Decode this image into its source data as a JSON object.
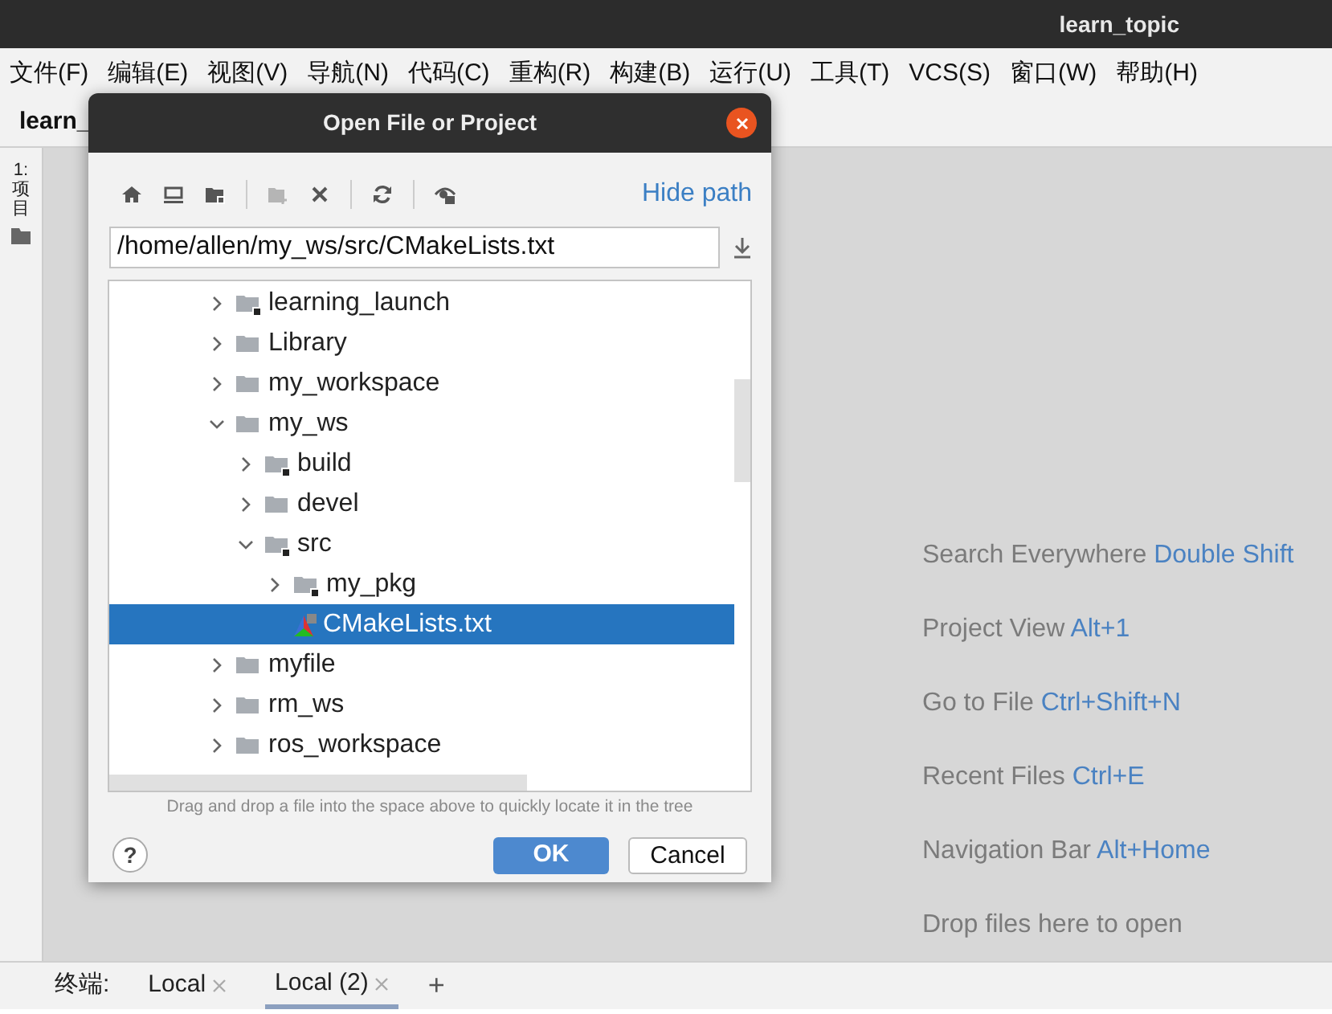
{
  "window": {
    "title": "learn_topic"
  },
  "menu": [
    "文件(F)",
    "编辑(E)",
    "视图(V)",
    "导航(N)",
    "代码(C)",
    "重构(R)",
    "构建(B)",
    "运行(U)",
    "工具(T)",
    "VCS(S)",
    "窗口(W)",
    "帮助(H)"
  ],
  "project_tab": "learn_",
  "side_tool": "1: 项目",
  "hints": [
    {
      "text": "Search Everywhere",
      "shortcut": "Double Shift"
    },
    {
      "text": "Project View",
      "shortcut": "Alt+1"
    },
    {
      "text": "Go to File",
      "shortcut": "Ctrl+Shift+N"
    },
    {
      "text": "Recent Files",
      "shortcut": "Ctrl+E"
    },
    {
      "text": "Navigation Bar",
      "shortcut": "Alt+Home"
    },
    {
      "text": "Drop files here to open"
    }
  ],
  "terminal": {
    "label": "终端:",
    "tabs": [
      {
        "label": "Local",
        "selected": false
      },
      {
        "label": "Local (2)",
        "selected": true
      }
    ],
    "add": "+"
  },
  "dialog": {
    "title": "Open File or Project",
    "hide_path": "Hide path",
    "path": "/home/allen/my_ws/src/CMakeLists.txt",
    "toolbar": [
      {
        "kind": "home",
        "disabled": false
      },
      {
        "kind": "desktop",
        "disabled": false
      },
      {
        "kind": "project",
        "disabled": false
      },
      {
        "kind": "sep"
      },
      {
        "kind": "new-folder",
        "disabled": true
      },
      {
        "kind": "delete",
        "disabled": false
      },
      {
        "kind": "sep"
      },
      {
        "kind": "refresh",
        "disabled": false
      },
      {
        "kind": "sep"
      },
      {
        "kind": "hidden",
        "disabled": false
      }
    ],
    "tree": [
      {
        "label": "learning_launch",
        "kind": "module",
        "expanded": false,
        "selected": false
      },
      {
        "label": "Library",
        "kind": "folder",
        "expanded": false,
        "selected": false
      },
      {
        "label": "my_workspace",
        "kind": "folder",
        "expanded": false,
        "selected": false
      },
      {
        "label": "my_ws",
        "kind": "folder",
        "expanded": true,
        "selected": false,
        "children": [
          {
            "label": "build",
            "kind": "module",
            "expanded": false,
            "selected": false
          },
          {
            "label": "devel",
            "kind": "folder",
            "expanded": false,
            "selected": false
          },
          {
            "label": "src",
            "kind": "module",
            "expanded": true,
            "selected": false,
            "children": [
              {
                "label": "my_pkg",
                "kind": "module",
                "expanded": false,
                "selected": false
              },
              {
                "label": "CMakeLists.txt",
                "kind": "cmake",
                "selected": true
              }
            ]
          }
        ]
      },
      {
        "label": "myfile",
        "kind": "folder",
        "expanded": false,
        "selected": false
      },
      {
        "label": "rm_ws",
        "kind": "folder",
        "expanded": false,
        "selected": false
      },
      {
        "label": "ros_workspace",
        "kind": "folder",
        "expanded": false,
        "selected": false
      }
    ],
    "hint": "Drag and drop a file into the space above to quickly locate it in the tree",
    "help": "?",
    "ok": "OK",
    "cancel": "Cancel"
  }
}
